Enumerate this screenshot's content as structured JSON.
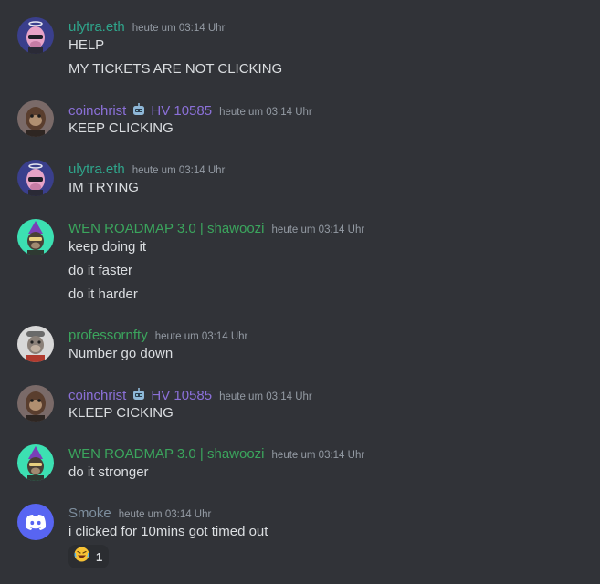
{
  "messages": [
    {
      "username": "ulytra.eth",
      "name_color": "#2fa58b",
      "timestamp": "heute um 03:14 Uhr",
      "avatar_icon": "bored-ape-pink-avatar",
      "lines": [
        "HELP",
        "MY TICKETS ARE NOT CLICKING"
      ]
    },
    {
      "username": "coinchrist",
      "role_tag": "HV 10585",
      "name_color": "#8b70d8",
      "timestamp": "heute um 03:14 Uhr",
      "avatar_icon": "bored-ape-brown-avatar",
      "lines": [
        "KEEP CLICKING"
      ]
    },
    {
      "username": "ulytra.eth",
      "name_color": "#2fa58b",
      "timestamp": "heute um 03:14 Uhr",
      "avatar_icon": "bored-ape-pink-avatar",
      "lines": [
        "IM TRYING"
      ]
    },
    {
      "username": "WEN ROADMAP 3.0 | shawoozi",
      "name_color": "#3ba55d",
      "timestamp": "heute um 03:14 Uhr",
      "avatar_icon": "bored-ape-wizard-avatar",
      "lines": [
        "keep doing it",
        "do it faster",
        "do it harder"
      ]
    },
    {
      "username": "professornfty",
      "name_color": "#3ba55d",
      "timestamp": "heute um 03:14 Uhr",
      "avatar_icon": "bored-ape-grey-avatar",
      "lines": [
        "Number go down"
      ]
    },
    {
      "username": "coinchrist",
      "role_tag": "HV 10585",
      "name_color": "#8b70d8",
      "timestamp": "heute um 03:14 Uhr",
      "avatar_icon": "bored-ape-brown-avatar",
      "lines": [
        "KLEEP CICKING"
      ]
    },
    {
      "username": "WEN ROADMAP 3.0 | shawoozi",
      "name_color": "#3ba55d",
      "timestamp": "heute um 03:14 Uhr",
      "avatar_icon": "bored-ape-wizard-avatar",
      "lines": [
        "do it stronger"
      ]
    },
    {
      "username": "Smoke",
      "name_color": "#7e8f9e",
      "timestamp": "heute um 03:14 Uhr",
      "avatar_icon": "discord-default-avatar",
      "lines": [
        "i clicked for 10mins got timed out"
      ],
      "reaction": {
        "emoji_icon": "rofl-emoji-icon",
        "count": "1"
      }
    }
  ]
}
